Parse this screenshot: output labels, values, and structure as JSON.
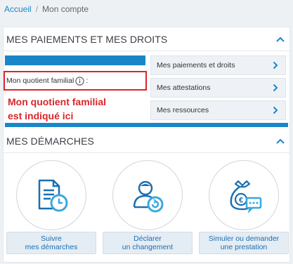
{
  "breadcrumb": {
    "home": "Accueil",
    "separator": "/",
    "current": "Mon compte"
  },
  "panel1": {
    "title": "MES PAIEMENTS ET MES DROITS",
    "quotient_label": "Mon quotient familial",
    "quotient_suffix": ":",
    "annotation_line1": "Mon quotient familial",
    "annotation_line2": "est indiqué ici",
    "links": [
      {
        "label": "Mes paiements et droits"
      },
      {
        "label": "Mes attestations"
      },
      {
        "label": "Mes ressources"
      }
    ]
  },
  "panel2": {
    "title": "MES DÉMARCHES",
    "tiles": [
      {
        "icon": "document-clock-icon",
        "line1": "Suivre",
        "line2": "mes démarches"
      },
      {
        "icon": "user-refresh-icon",
        "line1": "Déclarer",
        "line2": "un changement"
      },
      {
        "icon": "money-bag-chat-icon",
        "line1": "Simuler ou demander",
        "line2": "une prestation"
      }
    ]
  },
  "colors": {
    "accent": "#1b86c7",
    "annotation": "#d9262b",
    "tile_button_bg": "#e4ecf4"
  }
}
